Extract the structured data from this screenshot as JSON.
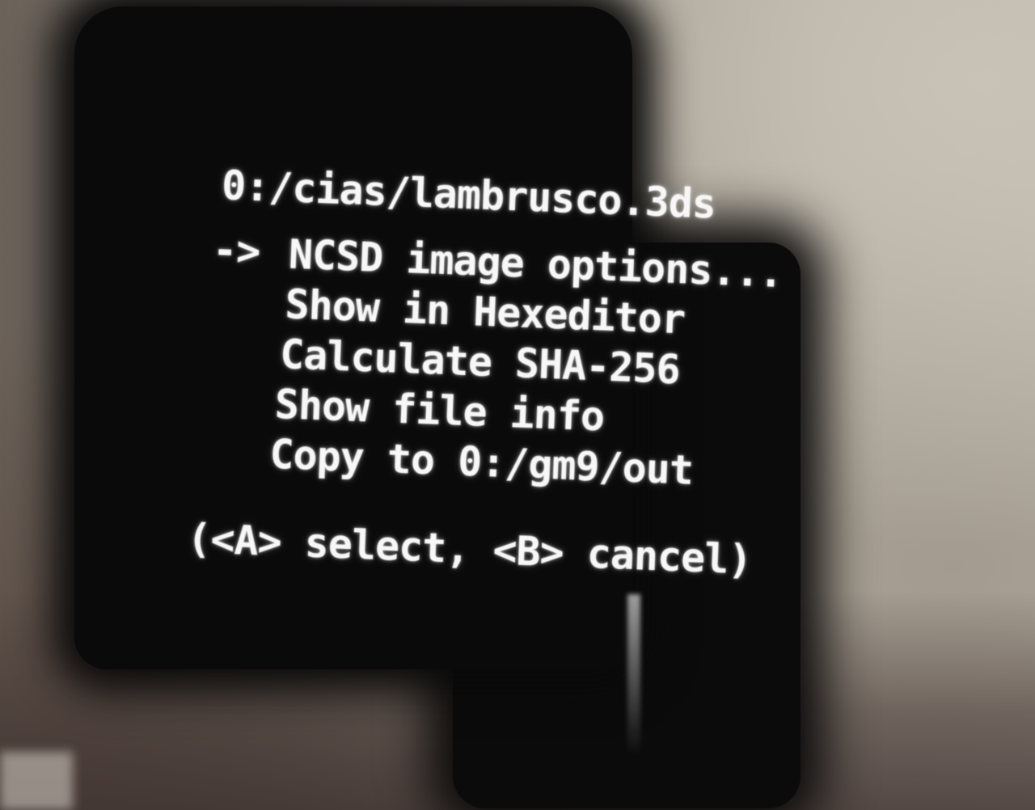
{
  "path": "0:/cias/lambrusco.3ds",
  "cursor": "->",
  "menu": {
    "selected_index": 0,
    "items": [
      {
        "label": "NCSD image options..."
      },
      {
        "label": "Show in Hexeditor"
      },
      {
        "label": "Calculate SHA-256"
      },
      {
        "label": "Show file info"
      },
      {
        "label": "Copy to 0:/gm9/out"
      }
    ]
  },
  "hint": "(<A> select, <B> cancel)",
  "colors": {
    "screen_background": "#0a0a0a",
    "text": "#f7f7f7"
  }
}
